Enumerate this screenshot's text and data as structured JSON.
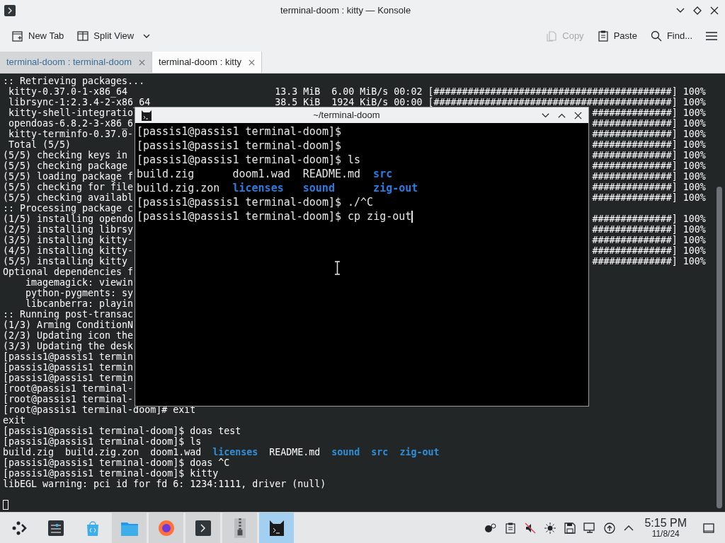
{
  "window": {
    "title": "terminal-doom : kitty — Konsole"
  },
  "toolbar": {
    "new_tab": "New Tab",
    "split_view": "Split View",
    "copy": {
      "label": "Copy",
      "disabled": true
    },
    "paste": "Paste",
    "find": "Find..."
  },
  "tabs": [
    {
      "label": "terminal-doom : terminal-doom",
      "selected": false
    },
    {
      "label": "terminal-doom : kitty",
      "selected": true
    }
  ],
  "terminal": {
    "lines": [
      {
        "kind": "text",
        "text": ":: Retrieving packages..."
      },
      {
        "kind": "text",
        "text": " kitty-0.37.0-1-x86_64",
        "right": "13.3 MiB  6.00 MiB/s 00:02 [##########################################] 100%"
      },
      {
        "kind": "text",
        "text": " librsync-1:2.3.4-2-x86_64",
        "right": "38.5 KiB  1924 KiB/s 00:00 [##########################################] 100%"
      },
      {
        "kind": "text",
        "text": " kitty-shell-integratio",
        "right": "##############] 100%"
      },
      {
        "kind": "text",
        "text": " opendoas-6.8.2-3-x86_6",
        "right": "##############] 100%"
      },
      {
        "kind": "text",
        "text": " kitty-terminfo-0.37.0-",
        "right": "##############] 100%"
      },
      {
        "kind": "text",
        "text": " Total (5/5)",
        "right": "##############] 100%"
      },
      {
        "kind": "text",
        "text": "(5/5) checking keys in",
        "right": "##############] 100%"
      },
      {
        "kind": "text",
        "text": "(5/5) checking package",
        "right": "##############] 100%"
      },
      {
        "kind": "text",
        "text": "(5/5) loading package f",
        "right": "##############] 100%"
      },
      {
        "kind": "text",
        "text": "(5/5) checking for file",
        "right": "##############] 100%"
      },
      {
        "kind": "text",
        "text": "(5/5) checking availabl",
        "right": "##############] 100%"
      },
      {
        "kind": "text",
        "text": ":: Processing package c"
      },
      {
        "kind": "text",
        "text": "(1/5) installing opendo",
        "right": "##############] 100%"
      },
      {
        "kind": "text",
        "text": "(2/5) installing librsy",
        "right": "##############] 100%"
      },
      {
        "kind": "text",
        "text": "(3/5) installing kitty-",
        "right": "##############] 100%"
      },
      {
        "kind": "text",
        "text": "(4/5) installing kitty-",
        "right": "##############] 100%"
      },
      {
        "kind": "text",
        "text": "(5/5) installing kitty",
        "right": "##############] 100%"
      },
      {
        "kind": "text",
        "text": "Optional dependencies f"
      },
      {
        "kind": "text",
        "text": "    imagemagick: viewin"
      },
      {
        "kind": "text",
        "text": "    python-pygments: sy"
      },
      {
        "kind": "text",
        "text": "    libcanberra: playin"
      },
      {
        "kind": "text",
        "text": ":: Running post-transac"
      },
      {
        "kind": "text",
        "text": "(1/3) Arming ConditionN"
      },
      {
        "kind": "text",
        "text": "(2/3) Updating icon the"
      },
      {
        "kind": "text",
        "text": "(3/3) Updating the desk"
      },
      {
        "kind": "text",
        "text": "[passis1@passis1 termin"
      },
      {
        "kind": "text",
        "text": "[passis1@passis1 termin"
      },
      {
        "kind": "text",
        "text": "[passis1@passis1 termin"
      },
      {
        "kind": "text",
        "text": "[root@passis1 terminal-"
      },
      {
        "kind": "text",
        "text": "[root@passis1 terminal-"
      },
      {
        "kind": "text",
        "text": "[root@passis1 terminal-doom]# exit"
      },
      {
        "kind": "text",
        "text": "exit"
      },
      {
        "kind": "text",
        "text": "[passis1@passis1 terminal-doom]$ doas test"
      },
      {
        "kind": "text",
        "text": "[passis1@passis1 terminal-doom]$ ls"
      },
      {
        "kind": "listing",
        "entries": [
          {
            "name": "build.zig",
            "dir": false
          },
          {
            "name": "build.zig.zon",
            "dir": false
          },
          {
            "name": "doom1.wad",
            "dir": false
          },
          {
            "name": "licenses",
            "dir": true
          },
          {
            "name": "README.md",
            "dir": false
          },
          {
            "name": "sound",
            "dir": true
          },
          {
            "name": "src",
            "dir": true
          },
          {
            "name": "zig-out",
            "dir": true
          }
        ]
      },
      {
        "kind": "text",
        "text": "[passis1@passis1 terminal-doom]$ doas ^C"
      },
      {
        "kind": "text",
        "text": "[passis1@passis1 terminal-doom]$ kitty"
      },
      {
        "kind": "text",
        "text": "libEGL warning: pci id for fd 6: 1234:1111, driver (null)"
      },
      {
        "kind": "blank"
      },
      {
        "kind": "cursor"
      }
    ]
  },
  "kitty": {
    "title": "~/terminal-doom",
    "lines": [
      {
        "kind": "text",
        "text": "[passis1@passis1 terminal-doom]$",
        "cursor": false
      },
      {
        "kind": "text",
        "text": "[passis1@passis1 terminal-doom]$",
        "cursor": false
      },
      {
        "kind": "text",
        "text": "[passis1@passis1 terminal-doom]$ ls",
        "cursor": false
      },
      {
        "kind": "listing",
        "entries": [
          {
            "name": "build.zig",
            "dir": false
          },
          {
            "name": "doom1.wad",
            "dir": false
          },
          {
            "name": "README.md",
            "dir": false
          },
          {
            "name": "src",
            "dir": true
          },
          {
            "name": "build.zig.zon",
            "dir": false
          },
          {
            "name": "licenses",
            "dir": true
          },
          {
            "name": "sound",
            "dir": true
          },
          {
            "name": "zig-out",
            "dir": true
          }
        ]
      },
      {
        "kind": "text",
        "text": "[passis1@passis1 terminal-doom]$ ./^C",
        "cursor": false
      },
      {
        "kind": "text",
        "text": "[passis1@passis1 terminal-doom]$ cp zig-out",
        "cursor": true
      }
    ]
  },
  "taskbar": {
    "apps": [
      {
        "running": false,
        "selected": false
      },
      {
        "running": false,
        "selected": false
      },
      {
        "running": true,
        "selected": false
      },
      {
        "running": true,
        "selected": false
      },
      {
        "running": true,
        "selected": false
      },
      {
        "running": true,
        "selected": false
      },
      {
        "running": true,
        "selected": true
      }
    ],
    "time": "5:15 PM",
    "date": "11/8/24"
  }
}
